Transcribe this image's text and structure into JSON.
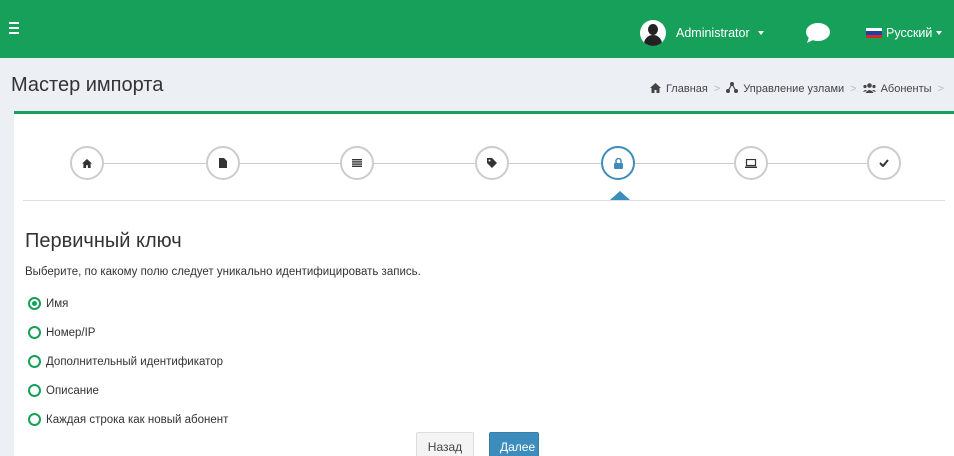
{
  "topbar": {
    "user_name": "Administrator",
    "language": "Русский",
    "brand_color": "#16a05a"
  },
  "header": {
    "title": "Мастер импорта"
  },
  "breadcrumb": [
    {
      "label": "Главная",
      "icon": "home-icon"
    },
    {
      "label": "Управление узлами",
      "icon": "sitemap-icon"
    },
    {
      "label": "Абоненты",
      "icon": "users-icon"
    }
  ],
  "wizard": {
    "steps": [
      {
        "icon": "home-icon"
      },
      {
        "icon": "file-icon"
      },
      {
        "icon": "list-icon"
      },
      {
        "icon": "tag-icon"
      },
      {
        "icon": "lock-icon",
        "active": true
      },
      {
        "icon": "laptop-icon"
      },
      {
        "icon": "check-icon"
      }
    ],
    "accent_color": "#3c8dbc"
  },
  "form": {
    "title": "Первичный ключ",
    "description": "Выберите, по какому полю следует уникально идентифицировать запись.",
    "options": [
      {
        "label": "Имя",
        "checked": true
      },
      {
        "label": "Номер/IP",
        "checked": false
      },
      {
        "label": "Дополнительный идентификатор",
        "checked": false
      },
      {
        "label": "Описание",
        "checked": false
      },
      {
        "label": "Каждая строка как новый абонент",
        "checked": false
      }
    ]
  },
  "actions": {
    "back_label": "Назад",
    "next_label": "Далее"
  }
}
